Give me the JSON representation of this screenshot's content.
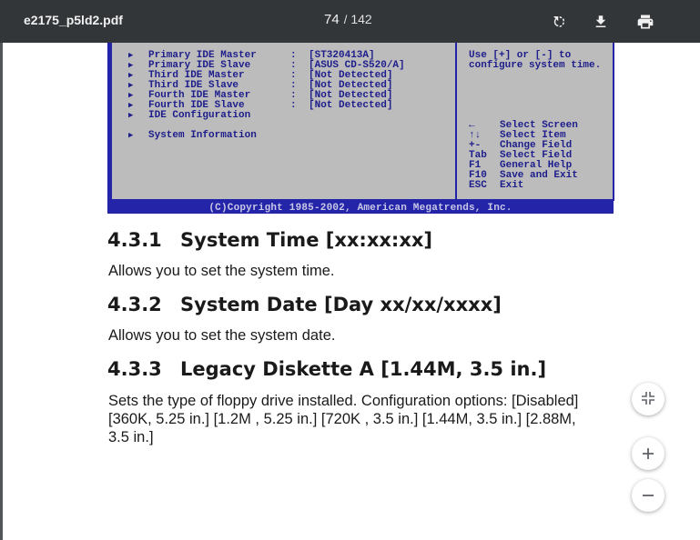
{
  "viewer": {
    "file_name": "e2175_p5ld2.pdf",
    "current_page": "74",
    "separator": "/",
    "total_pages": "142"
  },
  "icons": {
    "rotate": "rotate-icon",
    "download": "download-icon",
    "print": "print-icon",
    "fit": "fit-to-page-icon",
    "zoom_in": "zoom-in-icon",
    "zoom_out": "zoom-out-icon"
  },
  "bios": {
    "items": [
      {
        "label": "Primary IDE Master",
        "colon": ":",
        "value": "[ST320413A]"
      },
      {
        "label": "Primary IDE Slave",
        "colon": ":",
        "value": "[ASUS CD-S520/A]"
      },
      {
        "label": "Third IDE Master",
        "colon": ":",
        "value": "[Not Detected]"
      },
      {
        "label": "Third IDE Slave",
        "colon": ":",
        "value": "[Not Detected]"
      },
      {
        "label": "Fourth IDE Master",
        "colon": ":",
        "value": "[Not Detected]"
      },
      {
        "label": "Fourth IDE Slave",
        "colon": ":",
        "value": "[Not Detected]"
      },
      {
        "label": "IDE Configuration",
        "colon": "",
        "value": ""
      },
      {
        "label": "System Information",
        "colon": "",
        "value": ""
      }
    ],
    "help_text": "Use [+] or [-] to\nconfigure system time.",
    "keys": [
      {
        "key": "←",
        "desc": "Select Screen"
      },
      {
        "key": "↑↓",
        "desc": "Select Item"
      },
      {
        "key": "+-",
        "desc": "Change Field"
      },
      {
        "key": "Tab",
        "desc": "Select Field"
      },
      {
        "key": "F1",
        "desc": "General Help"
      },
      {
        "key": "F10",
        "desc": "Save and Exit"
      },
      {
        "key": "ESC",
        "desc": "Exit"
      }
    ],
    "copyright": "(C)Copyright 1985-2002, American Megatrends, Inc."
  },
  "sections": [
    {
      "number": "4.3.1",
      "title": "System Time [xx:xx:xx]",
      "body": "Allows you to set the system time."
    },
    {
      "number": "4.3.2",
      "title": "System Date [Day xx/xx/xxxx]",
      "body": "Allows you to set the system date."
    },
    {
      "number": "4.3.3",
      "title": "Legacy Diskette A [1.44M, 3.5 in.]",
      "body": "Sets the type of floppy drive installed. Configuration options: [Disabled] [360K, 5.25 in.] [1.2M , 5.25 in.] [720K , 3.5 in.] [1.44M, 3.5 in.] [2.88M, 3.5 in.]"
    }
  ],
  "colors": {
    "toolbar": "#323639",
    "bios_blue": "#2424a8",
    "bios_gray": "#bcbcbc"
  }
}
